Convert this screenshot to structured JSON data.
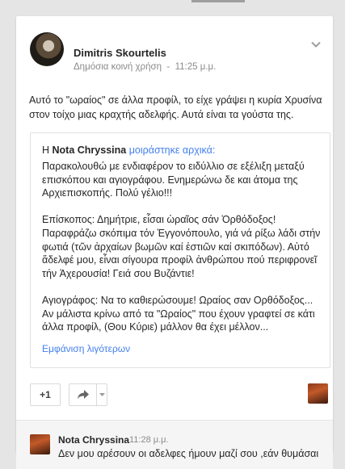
{
  "post": {
    "author": "Dimitris Skourtelis",
    "visibility": "Δημόσια κοινή χρήση",
    "separator": "-",
    "time": "11:25 μ.μ.",
    "text": "Αυτό το \"ωραίος\" σε άλλα προφίλ, το είχε γράψει η κυρία Χρυσίνα στον τοίχο μιας κραχτής αδελφής. Αυτά είναι τα γούστα της."
  },
  "shared": {
    "prefix": "Η",
    "author": "Nota Chryssina",
    "action": "μοιράστηκε αρχικά:",
    "paragraphs": [
      "Παρακολουθώ με ενδιαφέρον το ειδύλλιο σε εξέλιξη μεταξύ επισκόπου και αγιογράφου. Ενημερώνω δε και άτομα της Αρχιεπισκοπής. Πολύ γέλιο!!!",
      "Επίσκοπος: Δημήτριε, εἶσαι ὡραῖος σάν Ὀρθόδοξος! Παραφράζω σκόπιμα τόν Ἐγγονόπουλο, γιά νά ρίξω λάδι στήν φωτιά (τῶν ἀρχαίων βωμῶν καί ἐστιῶν καί σκιπόδων). Αὐτό ἄδελφέ μου, εἶναι σίγουρα προφίλ ἀνθρώπου πού περιφρονεῖ τήν Ἀχερουσία! Γειά σου Βυζάντιε!",
      "Αγιογράφος: Να το καθιερώσουμε! Ωραίος σαν Ορθόδοξος... Αν μάλιστα κρίνω από τα \"Ωραίος\" που έχουν γραφτεί σε κάτι άλλα προφίλ, (Θου Κύριε) μάλλον θα έχει μέλλον..."
    ],
    "show_more": "Εμφάνιση λιγότερων"
  },
  "actions": {
    "plus_one": "+1"
  },
  "comment": {
    "author": "Nota Chryssina",
    "time": "11:28 μ.μ.",
    "text": "Δεν μου αρέσουν οι αδελφες ήμουν μαζί σου ,εάν θυμάσαι"
  },
  "icons": {
    "menu": "chevron-down-icon",
    "share": "share-arrow-icon",
    "share_dropdown": "caret-down-icon"
  },
  "colors": {
    "link": "#427fed",
    "background": "#e5e5e5",
    "muted": "#8a8a8a"
  }
}
